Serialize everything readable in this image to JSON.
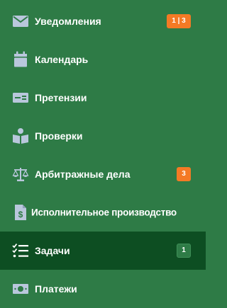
{
  "sidebar": {
    "items": [
      {
        "label": "Уведомления",
        "icon": "envelope-icon",
        "badge": "1 | 3",
        "badge_color": "#f47a25"
      },
      {
        "label": "Календарь",
        "icon": "calendar-icon"
      },
      {
        "label": "Претензии",
        "icon": "id-card-icon"
      },
      {
        "label": "Проверки",
        "icon": "reading-person-icon"
      },
      {
        "label": "Арбитражные дела",
        "icon": "scales-icon",
        "badge": "3",
        "badge_color": "#f47a25"
      },
      {
        "label": "Исполнительное производство",
        "icon": "dollar-document-icon"
      },
      {
        "label": "Задачи",
        "icon": "task-list-icon",
        "badge": "1",
        "badge_color": "#2e7b46",
        "active": true
      },
      {
        "label": "Платежи",
        "icon": "banknote-icon"
      }
    ]
  },
  "colors": {
    "background": "#2e7b46",
    "active_background": "#0d4e22",
    "icon": "#b9c7dc",
    "badge_orange": "#f47a25",
    "text": "#ffffff"
  }
}
